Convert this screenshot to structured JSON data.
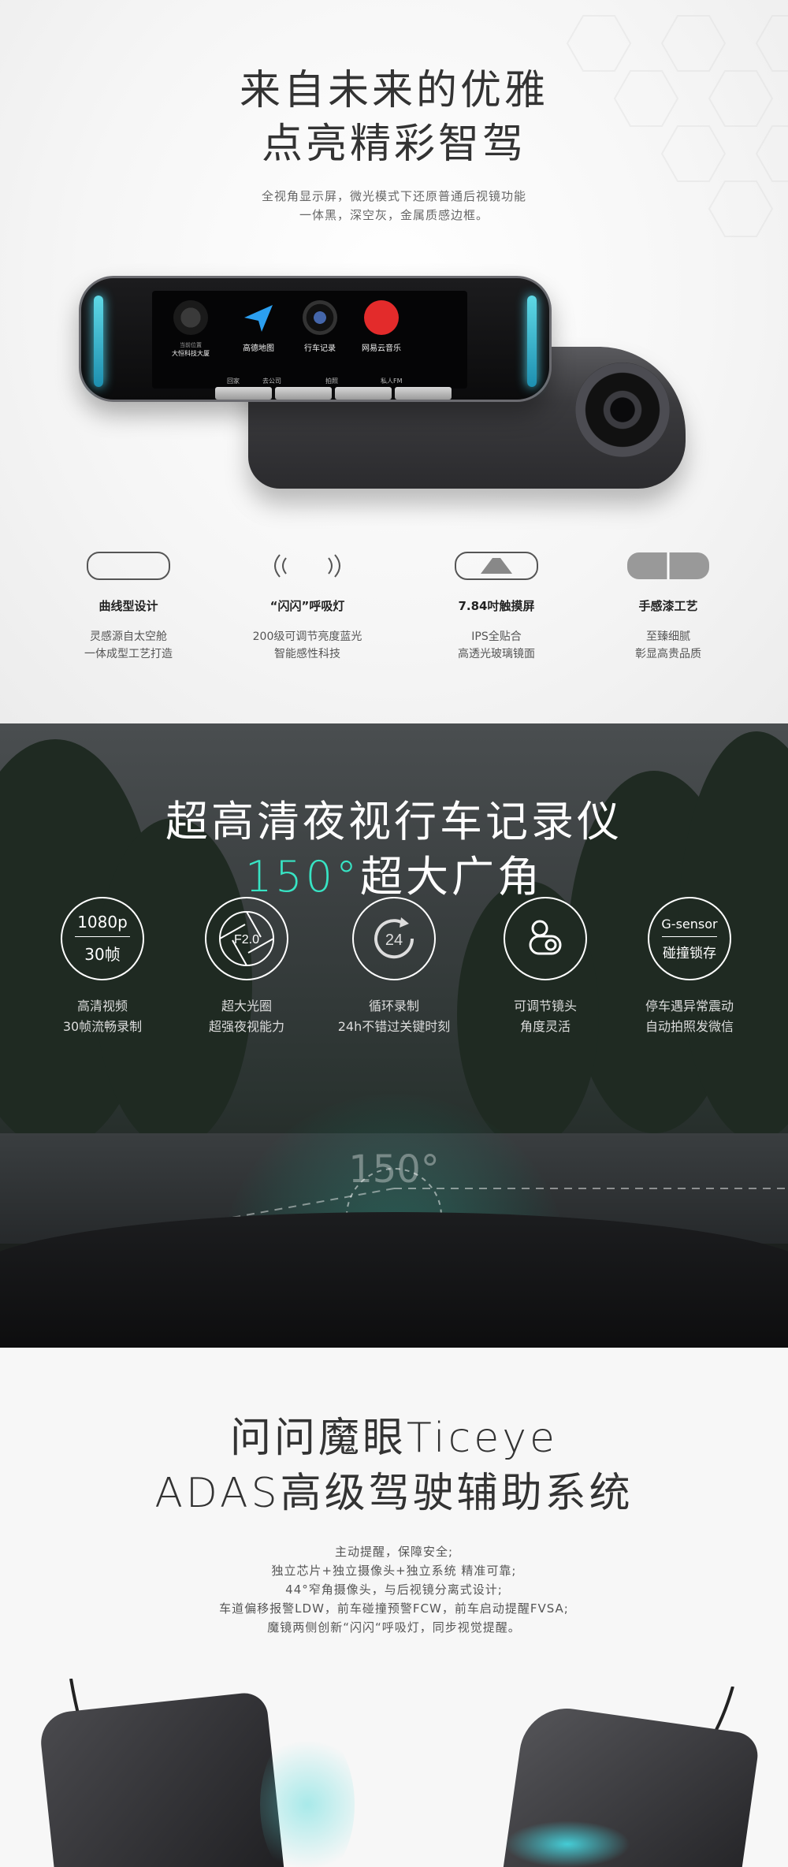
{
  "hero": {
    "title_line1": "来自未来的优雅",
    "title_line2": "点亮精彩智驾",
    "desc_line1": "全视角显示屏，微光模式下还原普通后视镜功能",
    "desc_line2": "一体黑，深空灰，金属质感边框。",
    "screen": {
      "apps": [
        "高德地图",
        "行车记录",
        "网易云音乐"
      ],
      "widget_top": "当前位置",
      "widget_bottom": "大恒科技大厦",
      "dock": [
        "回家",
        "去公司",
        "拍照",
        "私人FM"
      ]
    }
  },
  "features": [
    {
      "icon": "curved-frame-icon",
      "title": "曲线型设计",
      "line1": "灵感源自太空舱",
      "line2": "一体成型工艺打造"
    },
    {
      "icon": "breathing-light-icon",
      "title": "“闪闪”呼吸灯",
      "line1": "200级可调节亮度蓝光",
      "line2": "智能感性科技"
    },
    {
      "icon": "touch-screen-icon",
      "title": "7.84吋触摸屏",
      "line1": "IPS全贴合",
      "line2": "高透光玻璃镜面"
    },
    {
      "icon": "paint-finish-icon",
      "title": "手感漆工艺",
      "line1": "至臻细腻",
      "line2": "彰显高贵品质"
    }
  ],
  "night": {
    "title_line1": "超高清夜视行车记录仪",
    "title_accent": "150°",
    "title_rest": "超大广角",
    "fov_label": "150°",
    "accent_color": "#37e4c4",
    "items": [
      {
        "ring1": "1080p",
        "ring2": "30帧",
        "line1": "高清视频",
        "line2": "30帧流畅录制"
      },
      {
        "ring1": "F2.0",
        "ring2": "",
        "line1": "超大光圈",
        "line2": "超强夜视能力"
      },
      {
        "ring1": "24",
        "ring2": "",
        "line1": "循环录制",
        "line2": "24h不错过关键时刻"
      },
      {
        "ring1": "",
        "ring2": "",
        "line1": "可调节镜头",
        "line2": "角度灵活"
      },
      {
        "ring1": "G-sensor",
        "ring2": "碰撞锁存",
        "line1": "停车遇异常震动",
        "line2": "自动拍照发微信"
      }
    ]
  },
  "adas": {
    "title_line1": "问问魔眼Ticeye",
    "title_line2": "ADAS高级驾驶辅助系统",
    "lines": [
      "主动提醒，保障安全;",
      "独立芯片+独立摄像头+独立系统 精准可靠;",
      "44°窄角摄像头，与后视镜分离式设计;",
      "车道偏移报警LDW，前车碰撞预警FCW，前车启动提醒FVSA;",
      "魔镜两侧创新“闪闪“呼吸灯，同步视觉提醒。"
    ]
  }
}
